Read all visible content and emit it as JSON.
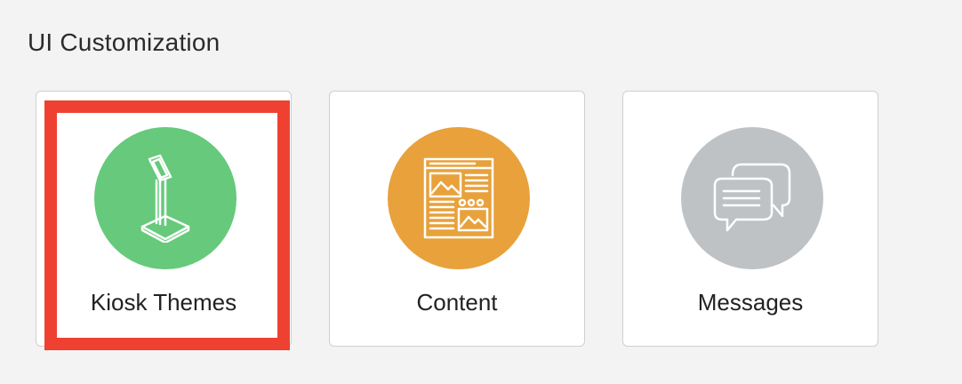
{
  "section": {
    "title": "UI Customization"
  },
  "cards": [
    {
      "label": "Kiosk Themes",
      "icon": "kiosk-icon",
      "color": "#66c97b"
    },
    {
      "label": "Content",
      "icon": "content-layout-icon",
      "color": "#e8a13b"
    },
    {
      "label": "Messages",
      "icon": "chat-bubbles-icon",
      "color": "#bfc2c5"
    }
  ],
  "highlight_color": "#ee4131"
}
